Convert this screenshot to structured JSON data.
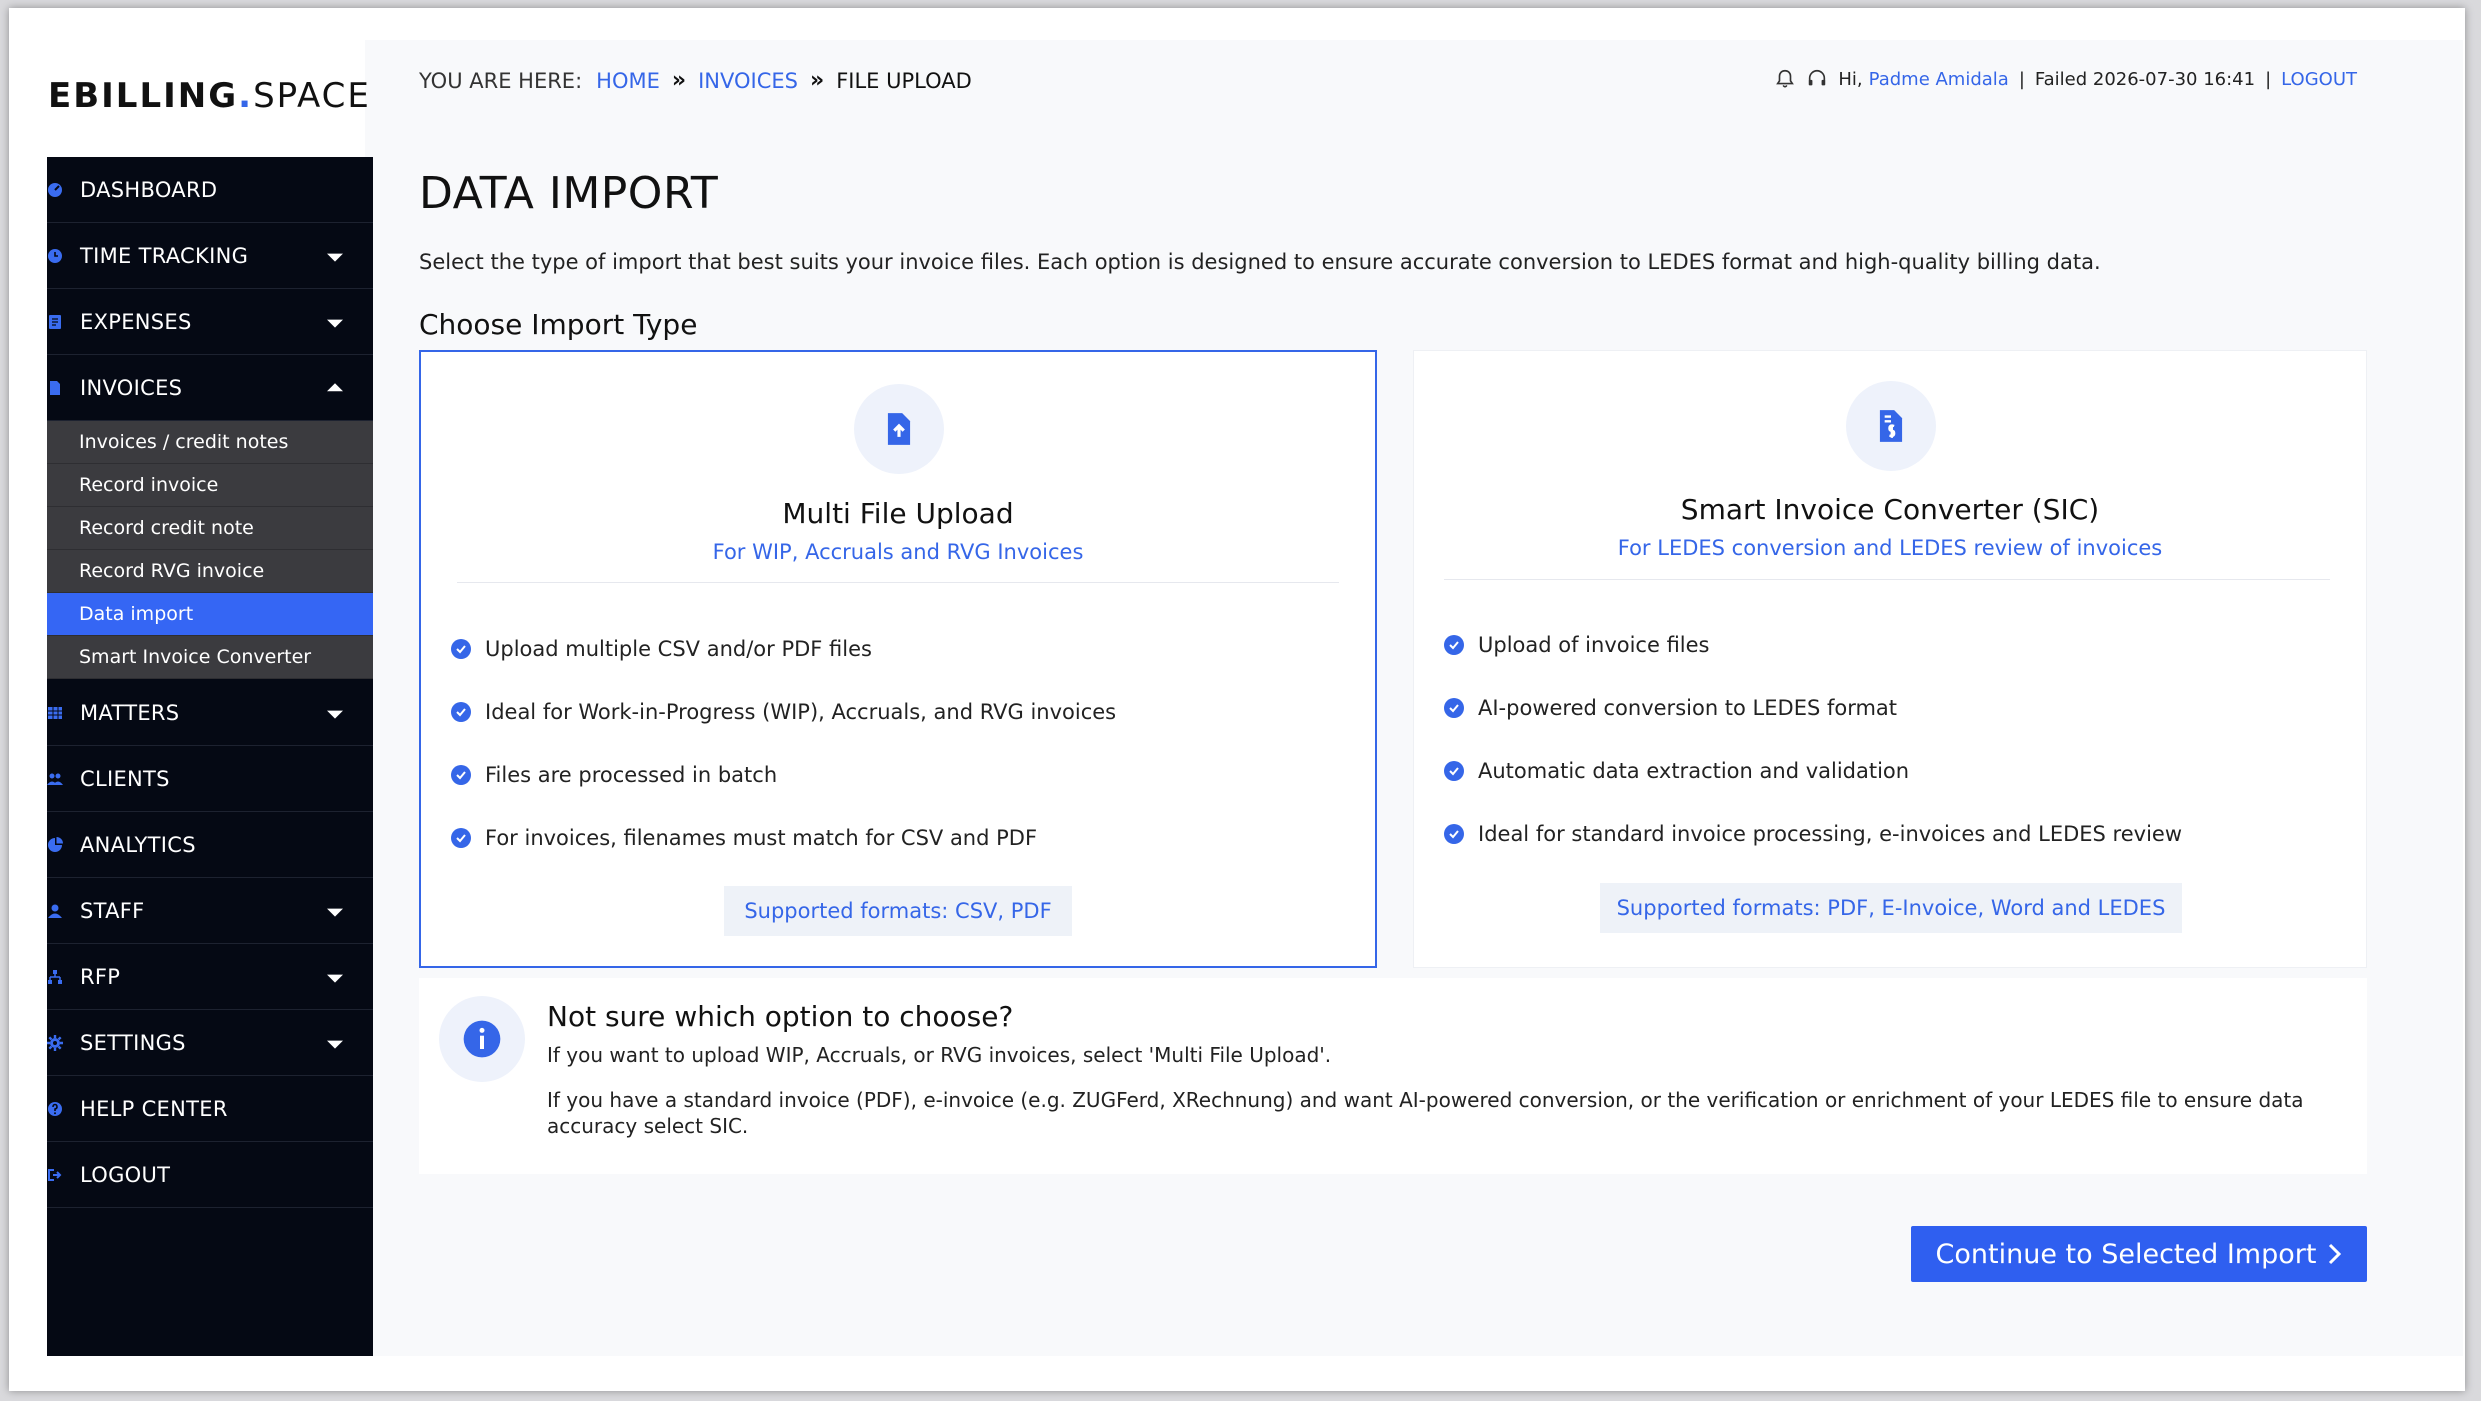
{
  "brand": {
    "name": "EBILLING",
    "dot": ".",
    "suffix": "SPACE"
  },
  "breadcrumb": {
    "label": "YOU ARE HERE:",
    "items": [
      "HOME",
      "INVOICES"
    ],
    "current": "FILE UPLOAD"
  },
  "userbar": {
    "greeting": "Hi,",
    "user": "Padme Amidala",
    "status": "Failed 2026-07-30 16:41",
    "logout": "LOGOUT",
    "separator": "|"
  },
  "sidebar": {
    "items": [
      {
        "label": "DASHBOARD",
        "icon": "dashboard-icon"
      },
      {
        "label": "TIME TRACKING",
        "icon": "clock-icon"
      },
      {
        "label": "EXPENSES",
        "icon": "receipt-icon"
      },
      {
        "label": "INVOICES",
        "icon": "file-icon"
      },
      {
        "label": "MATTERS",
        "icon": "grid-icon"
      },
      {
        "label": "CLIENTS",
        "icon": "users-icon"
      },
      {
        "label": "ANALYTICS",
        "icon": "pie-chart-icon"
      },
      {
        "label": "STAFF",
        "icon": "user-icon"
      },
      {
        "label": "RFP",
        "icon": "sitemap-icon"
      },
      {
        "label": "SETTINGS",
        "icon": "gear-icon"
      },
      {
        "label": "HELP CENTER",
        "icon": "help-icon"
      },
      {
        "label": "LOGOUT",
        "icon": "logout-icon"
      }
    ],
    "invoice_sub": [
      "Invoices / credit notes",
      "Record invoice",
      "Record credit note",
      "Record RVG invoice",
      "Data import",
      "Smart Invoice Converter"
    ]
  },
  "main": {
    "title": "DATA IMPORT",
    "intro": "Select the type of import that best suits your invoice files. Each option is designed to ensure accurate conversion to LEDES format and high-quality billing data.",
    "section_title": "Choose Import Type",
    "cards": [
      {
        "title": "Multi File Upload",
        "subtitle": "For WIP, Accruals and RVG Invoices",
        "features": [
          "Upload multiple CSV and/or PDF files",
          "Ideal for Work-in-Progress (WIP), Accruals, and RVG invoices",
          "Files are processed in batch",
          "For invoices, filenames must match for CSV and PDF"
        ],
        "formats": "Supported formats: CSV, PDF"
      },
      {
        "title": "Smart Invoice Converter (SIC)",
        "subtitle": "For LEDES conversion and LEDES review of invoices",
        "features": [
          "Upload of invoice files",
          "AI-powered conversion to LEDES format",
          "Automatic data extraction and validation",
          "Ideal for standard invoice processing, e-invoices and LEDES review"
        ],
        "formats": "Supported formats: PDF, E-Invoice, Word and LEDES"
      }
    ],
    "info": {
      "title": "Not sure which option to choose?",
      "line1": "If you want to upload WIP, Accruals, or RVG invoices, select 'Multi File Upload'.",
      "line2": "If you have a standard invoice (PDF), e-invoice (e.g. ZUGFerd, XRechnung) and want AI-powered conversion, or the verification or enrichment of your LEDES file to ensure data accuracy select SIC."
    },
    "continue_label": "Continue to Selected Import"
  },
  "colors": {
    "accent": "#3566e8",
    "nav_bg": "#050914",
    "active_sub": "#3566f4"
  }
}
